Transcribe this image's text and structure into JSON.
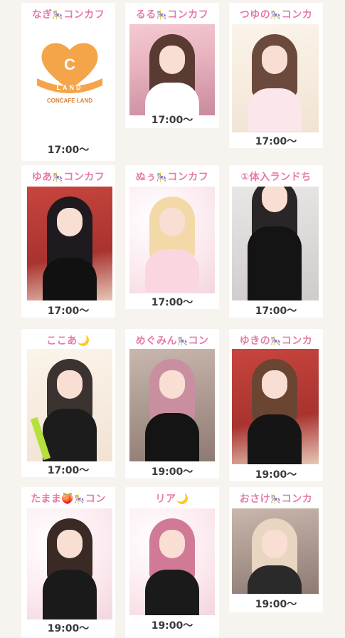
{
  "cards": [
    {
      "name": "なぎ",
      "suffix": "コンカフ",
      "time": "17:00〜"
    },
    {
      "name": "るる",
      "suffix": "コンカフ",
      "time": "17:00〜"
    },
    {
      "name": "つゆの",
      "suffix": "コンカ",
      "time": "17:00〜"
    },
    {
      "name": "ゆあ",
      "suffix": "コンカフ",
      "time": "17:00〜"
    },
    {
      "name": "ぬぅ",
      "suffix": "コンカフ",
      "time": "17:00〜"
    },
    {
      "name": "①体入ランドち",
      "suffix": "",
      "time": "17:00〜"
    },
    {
      "name": "ここあ",
      "suffix": "",
      "time": "17:00〜"
    },
    {
      "name": "めぐみん",
      "suffix": "コン",
      "time": "19:00〜"
    },
    {
      "name": "ゆきの",
      "suffix": "コンカ",
      "time": "19:00〜"
    },
    {
      "name": "たまま",
      "suffix": "コン",
      "time": "19:00〜"
    },
    {
      "name": "リア",
      "suffix": "",
      "time": "19:00〜"
    },
    {
      "name": "おさけ",
      "suffix": "コンカ",
      "time": "19:00〜"
    }
  ],
  "logo": {
    "letter": "C",
    "banner": "LAND",
    "title": "CONCAFE LAND"
  },
  "icons": {
    "horse": "carousel-horse-icon",
    "moon": "crescent-moon-icon",
    "peach": "peach-icon"
  },
  "colors": {
    "name_pink": "#e77aa6",
    "logo_orange": "#f4a54a",
    "time_text": "#3a3a3a",
    "page_bg": "#f7f3ee"
  }
}
